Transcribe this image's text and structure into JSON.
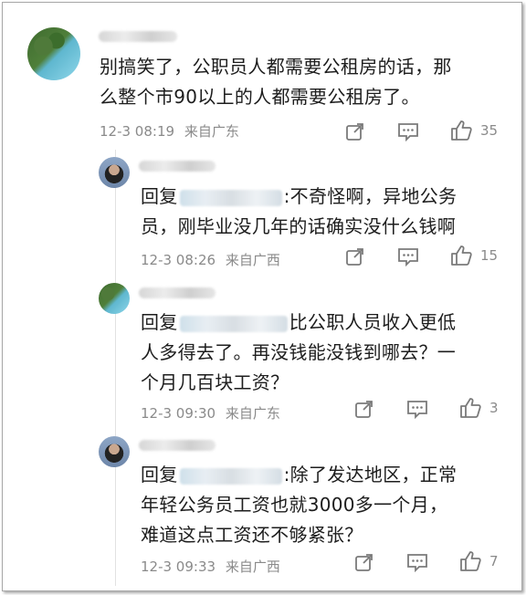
{
  "comments": [
    {
      "text": "别搞笑了，公职员人都需要公租房的话，那么整个市90以上的人都需要公租房了。",
      "line1": "别搞笑了，公职员人都需要公租房的话，那",
      "line2": "么整个市90以上的人都需要公租房了。",
      "timestamp": "12-3 08:19",
      "location": "来自广东",
      "likes": "35"
    }
  ],
  "replies": [
    {
      "prefix": "回复",
      "line1_after": ":不奇怪啊，异地公务",
      "line2": "员，刚毕业没几年的话确实没什么钱啊",
      "timestamp": "12-3 08:26",
      "location": "来自广西",
      "likes": "15"
    },
    {
      "prefix": "回复",
      "line1_after": "比公职人员收入更低",
      "line2": "人多得去了。再没钱能没钱到哪去？一",
      "line3": "个月几百块工资？",
      "timestamp": "12-3 09:30",
      "location": "来自广东",
      "likes": "3"
    },
    {
      "prefix": "回复",
      "line1_after": ":除了发达地区，正常",
      "line2": "年轻公务员工资也就3000多一个月，",
      "line3": "难道这点工资还不够紧张？",
      "timestamp": "12-3 09:33",
      "location": "来自广西",
      "likes": "7"
    }
  ],
  "icons": [
    "share-icon",
    "comment-icon",
    "like-icon"
  ],
  "colors": {
    "text": "#1d1d1d",
    "meta": "#8a8a8a"
  }
}
